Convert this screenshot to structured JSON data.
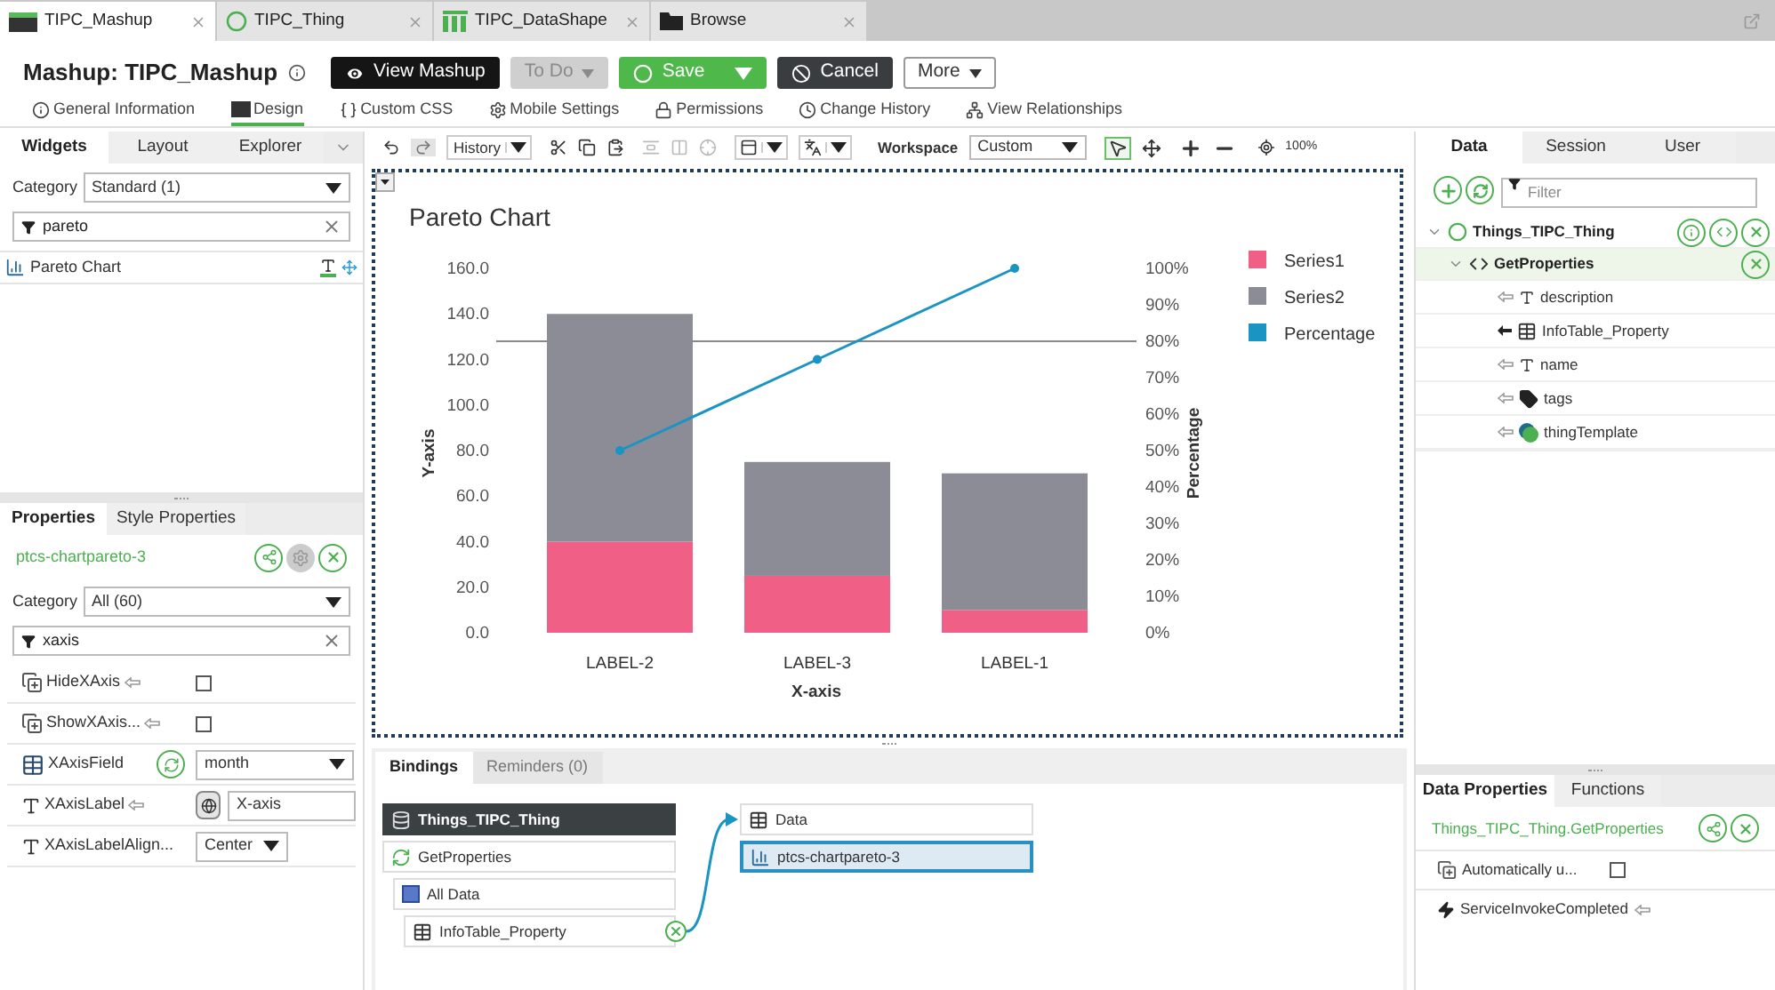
{
  "tabs": [
    {
      "label": "TIPC_Mashup",
      "kind": "mashup",
      "selected": true
    },
    {
      "label": "TIPC_Thing",
      "kind": "thing",
      "selected": false
    },
    {
      "label": "TIPC_DataShape",
      "kind": "datashape",
      "selected": false
    },
    {
      "label": "Browse",
      "kind": "browse",
      "selected": false
    }
  ],
  "header": {
    "prefix": "Mashup:",
    "title": "TIPC_Mashup",
    "buttons": [
      {
        "label": "View Mashup",
        "kind": "view",
        "disabled": false
      },
      {
        "label": "To Do",
        "kind": "menu",
        "disabled": true
      },
      {
        "label": "Save",
        "kind": "save",
        "disabled": false
      },
      {
        "label": "Cancel",
        "kind": "cancel",
        "disabled": false
      },
      {
        "label": "More",
        "kind": "menu",
        "disabled": false
      }
    ]
  },
  "nav": [
    {
      "label": "General Information",
      "kind": "info",
      "selected": false
    },
    {
      "label": "Design",
      "kind": "design",
      "selected": true
    },
    {
      "label": "Custom CSS",
      "kind": "css",
      "selected": false
    },
    {
      "label": "Mobile Settings",
      "kind": "mobile",
      "selected": false
    },
    {
      "label": "Permissions",
      "kind": "permissions",
      "selected": false
    },
    {
      "label": "Change History",
      "kind": "history",
      "selected": false
    },
    {
      "label": "View Relationships",
      "kind": "relationships",
      "selected": false
    }
  ],
  "widgets_panel": {
    "tabs": [
      {
        "label": "Widgets",
        "selected": true
      },
      {
        "label": "Layout",
        "selected": false
      },
      {
        "label": "Explorer",
        "selected": false
      }
    ],
    "category_label": "Category",
    "category": "Standard (1)",
    "search": "pareto",
    "items": [
      {
        "label": "Pareto Chart"
      }
    ]
  },
  "properties_panel": {
    "tabs": [
      {
        "label": "Properties",
        "selected": true
      },
      {
        "label": "Style Properties",
        "selected": false
      }
    ],
    "widget_id": "ptcs-chartpareto-3",
    "category_label": "Category",
    "category": "All (60)",
    "search": "xaxis",
    "properties": [
      {
        "label": "HideXAxis",
        "bindable": true,
        "kind": "checkbox",
        "checked": false
      },
      {
        "label": "ShowXAxis...",
        "bindable": true,
        "kind": "checkbox",
        "checked": false
      },
      {
        "label": "XAxisField",
        "bindable": false,
        "kind": "fieldselect",
        "value": "month"
      },
      {
        "label": "XAxisLabel",
        "bindable": true,
        "kind": "text",
        "value": "X-axis"
      },
      {
        "label": "XAxisLabelAlign...",
        "bindable": false,
        "kind": "select",
        "value": "Center"
      }
    ]
  },
  "toolbar": {
    "history": "History",
    "workspace_label": "Workspace",
    "workspace": "Custom",
    "zoom": "100%"
  },
  "canvas": {
    "chart_data": {
      "type": "bar",
      "stacked": true,
      "title": "Pareto Chart",
      "xlabel": "X-axis",
      "ylabel": "Y-axis",
      "y2label": "Percentage",
      "categories": [
        "LABEL-2",
        "LABEL-3",
        "LABEL-1"
      ],
      "series": [
        {
          "name": "Series1",
          "type": "bar",
          "color": "#ef5f86",
          "values": [
            40,
            25,
            10
          ]
        },
        {
          "name": "Series2",
          "type": "bar",
          "color": "#8c8c97",
          "values": [
            100,
            50,
            60
          ]
        },
        {
          "name": "Percentage",
          "type": "line",
          "color": "#1a94c2",
          "values": [
            50,
            75,
            100
          ],
          "axis": "y2",
          "marker": "circle"
        }
      ],
      "legend": "right",
      "ylim": [
        0,
        160
      ],
      "y2lim": [
        0,
        100
      ],
      "yticks": [
        {
          "value": 0,
          "label": "0.0"
        },
        {
          "value": 20,
          "label": "20.0"
        },
        {
          "value": 40,
          "label": "40.0"
        },
        {
          "value": 60,
          "label": "60.0"
        },
        {
          "value": 80,
          "label": "80.0"
        },
        {
          "value": 100,
          "label": "100.0"
        },
        {
          "value": 120,
          "label": "120.0"
        },
        {
          "value": 140,
          "label": "140.0"
        },
        {
          "value": 160,
          "label": "160.0"
        }
      ],
      "y2ticks": [
        {
          "value": 0,
          "label": "0%"
        },
        {
          "value": 10,
          "label": "10%"
        },
        {
          "value": 20,
          "label": "20%"
        },
        {
          "value": 30,
          "label": "30%"
        },
        {
          "value": 40,
          "label": "40%"
        },
        {
          "value": 50,
          "label": "50%"
        },
        {
          "value": 60,
          "label": "60%"
        },
        {
          "value": 70,
          "label": "70%"
        },
        {
          "value": 80,
          "label": "80%"
        },
        {
          "value": 90,
          "label": "90%"
        },
        {
          "value": 100,
          "label": "100%"
        }
      ],
      "ref_lines": [
        {
          "axis": "y2",
          "value": 80
        }
      ]
    }
  },
  "bindings": {
    "tabs": [
      {
        "label": "Bindings",
        "selected": true
      },
      {
        "label": "Reminders (0)",
        "selected": false
      }
    ],
    "sources": [
      {
        "label": "Things_TIPC_Thing",
        "kind": "thing",
        "children": [
          {
            "label": "GetProperties",
            "kind": "service",
            "children": [
              {
                "label": "All Data",
                "kind": "alldata",
                "children": [
                  {
                    "label": "InfoTable_Property",
                    "kind": "infotable",
                    "bound": true
                  }
                ]
              }
            ]
          }
        ]
      }
    ],
    "targets": [
      {
        "label": "Data",
        "kind": "infotable",
        "selected": false
      },
      {
        "label": "ptcs-chartpareto-3",
        "kind": "chart",
        "selected": true
      }
    ]
  },
  "data_panel": {
    "tabs": [
      {
        "label": "Data",
        "selected": true
      },
      {
        "label": "Session",
        "selected": false
      },
      {
        "label": "User",
        "selected": false
      }
    ],
    "filter_placeholder": "Filter",
    "tree": [
      {
        "label": "Things_TIPC_Thing",
        "kind": "thing",
        "expanded": true,
        "selected": false,
        "children": [
          {
            "label": "GetProperties",
            "kind": "service",
            "expanded": true,
            "selected": true,
            "children": [
              {
                "label": "description",
                "kind": "string",
                "selected": false
              },
              {
                "label": "InfoTable_Property",
                "kind": "infotable",
                "selected": false
              },
              {
                "label": "name",
                "kind": "string",
                "selected": false
              },
              {
                "label": "tags",
                "kind": "tags",
                "selected": false
              },
              {
                "label": "thingTemplate",
                "kind": "template",
                "selected": false
              }
            ]
          }
        ]
      }
    ],
    "properties_tabs": [
      {
        "label": "Data Properties",
        "selected": true
      },
      {
        "label": "Functions",
        "selected": false
      }
    ],
    "title": "Things_TIPC_Thing.GetProperties",
    "properties": [
      {
        "label": "Automatically u...",
        "kind": "checkbox",
        "checked": false
      },
      {
        "label": "ServiceInvokeCompleted",
        "kind": "event"
      }
    ]
  }
}
